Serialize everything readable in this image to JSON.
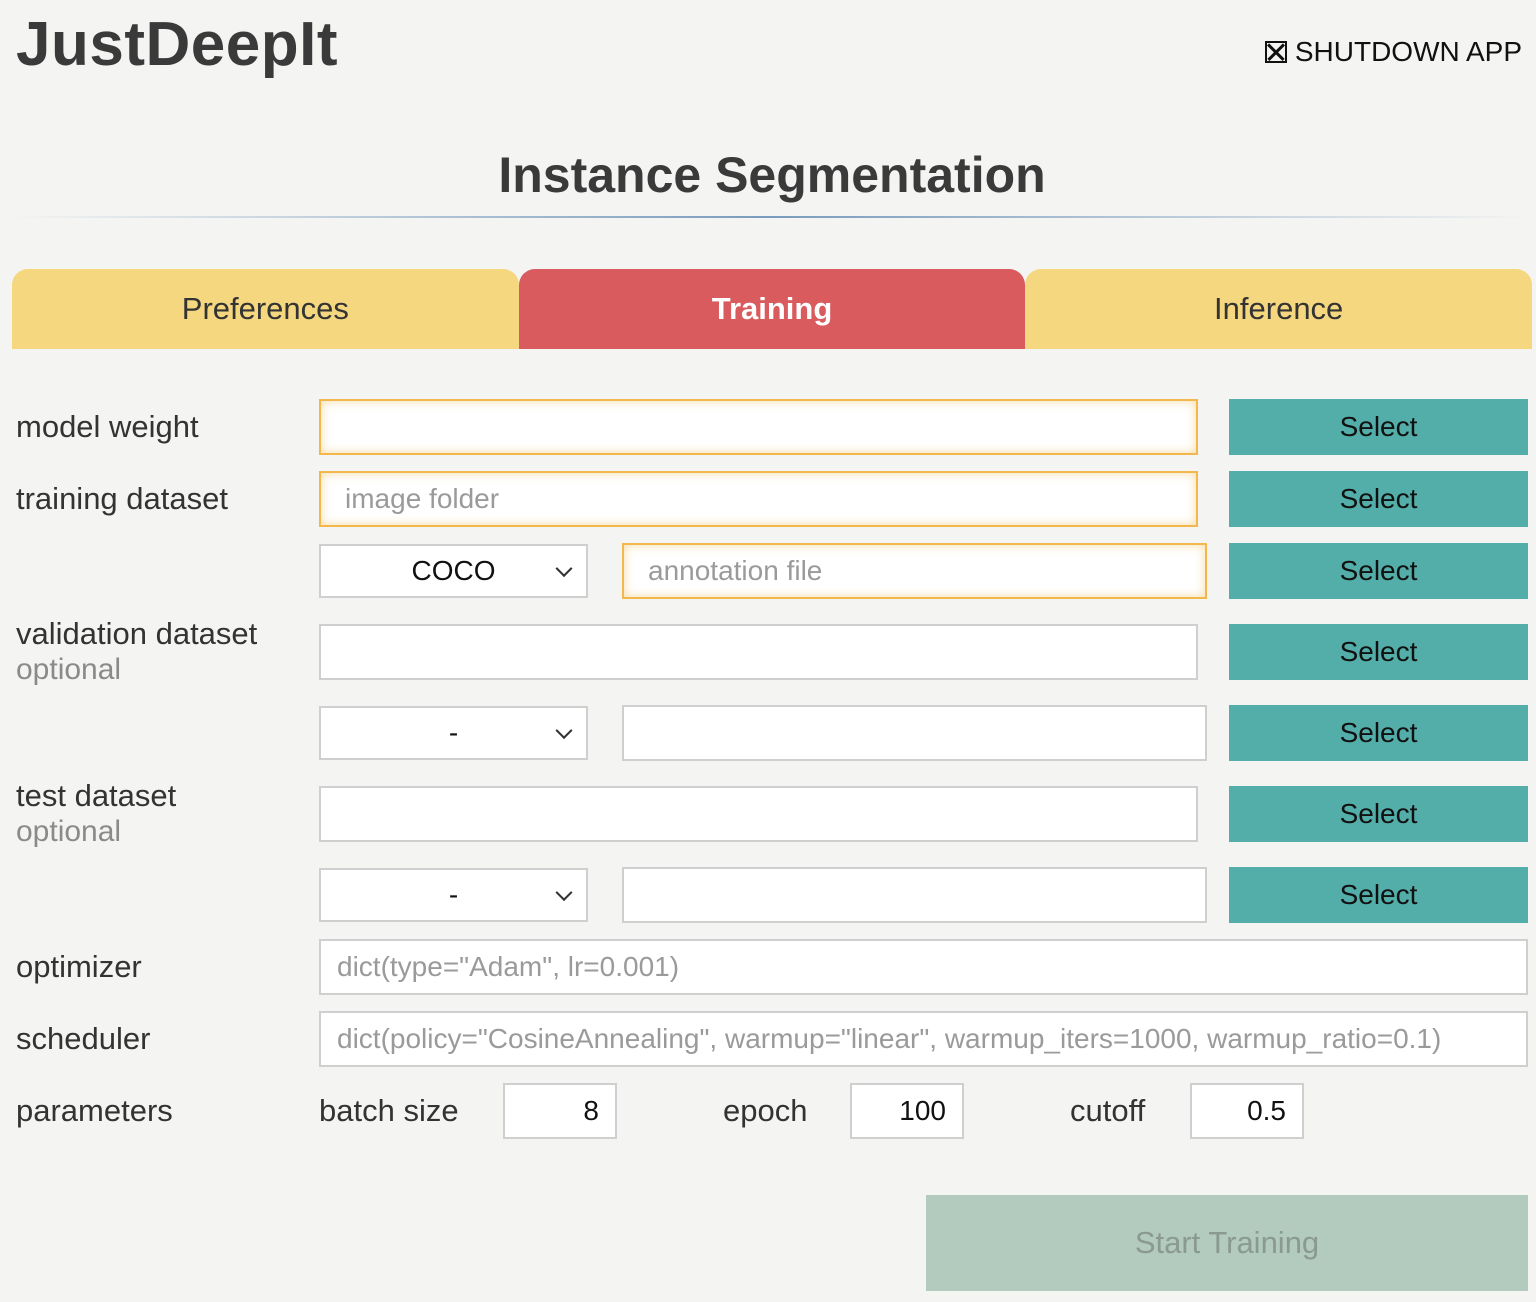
{
  "app": {
    "title": "JustDeepIt",
    "shutdown_label": "SHUTDOWN APP"
  },
  "page": {
    "title": "Instance Segmentation"
  },
  "tabs": [
    {
      "label": "Preferences",
      "active": false
    },
    {
      "label": "Training",
      "active": true
    },
    {
      "label": "Inference",
      "active": false
    }
  ],
  "form": {
    "select_label": "Select",
    "model_weight": {
      "label": "model weight",
      "value": ""
    },
    "training_dataset": {
      "label": "training dataset",
      "image_placeholder": "image folder",
      "format": "COCO",
      "annotation_placeholder": "annotation file"
    },
    "validation_dataset": {
      "label": "validation dataset",
      "sublabel": "optional",
      "format": "-"
    },
    "test_dataset": {
      "label": "test dataset",
      "sublabel": "optional",
      "format": "-"
    },
    "optimizer": {
      "label": "optimizer",
      "placeholder": "dict(type=\"Adam\", lr=0.001)"
    },
    "scheduler": {
      "label": "scheduler",
      "placeholder": "dict(policy=\"CosineAnnealing\", warmup=\"linear\", warmup_iters=1000, warmup_ratio=0.1)"
    },
    "parameters": {
      "label": "parameters",
      "batch_size": {
        "label": "batch size",
        "value": "8"
      },
      "epoch": {
        "label": "epoch",
        "value": "100"
      },
      "cutoff": {
        "label": "cutoff",
        "value": "0.5"
      }
    }
  },
  "start_button": {
    "label": "Start Training",
    "enabled": false
  },
  "colors": {
    "tab_inactive": "#f5d77f",
    "tab_active": "#d95b5e",
    "select_button": "#53aea9",
    "warning_border": "#f2b84b",
    "start_disabled": "#b2cbbe"
  }
}
